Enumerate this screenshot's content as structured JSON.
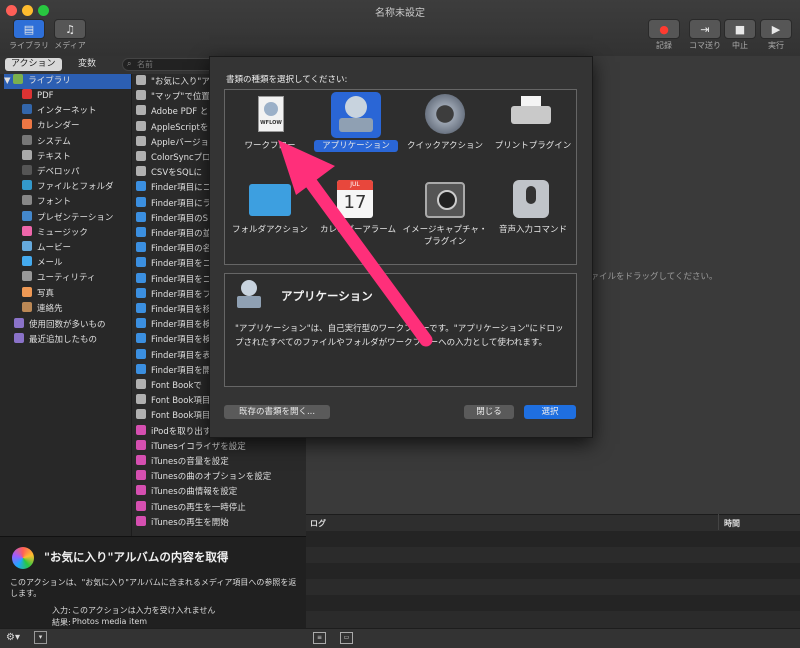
{
  "window": {
    "title": "名称未設定"
  },
  "toolbar": {
    "left": [
      {
        "label": "ライブラリ"
      },
      {
        "label": "メディア"
      }
    ],
    "right": [
      {
        "label": "記録"
      },
      {
        "label": "コマ送り"
      },
      {
        "label": "中止"
      },
      {
        "label": "実行"
      }
    ]
  },
  "tabs": {
    "actions": "アクション",
    "variables": "変数"
  },
  "search": {
    "placeholder": "名前"
  },
  "library": {
    "root": "ライブラリ",
    "items": [
      "PDF",
      "インターネット",
      "カレンダー",
      "システム",
      "テキスト",
      "デベロッパ",
      "ファイルとフォルダ",
      "フォント",
      "プレゼンテーション",
      "ミュージック",
      "ムービー",
      "メール",
      "ユーティリティ",
      "写真",
      "連絡先"
    ],
    "extra": [
      "使用回数が多いもの",
      "最近追加したもの"
    ]
  },
  "actions": [
    "\"お気に入り\"ア",
    "\"マップ\"で位置を",
    "Adobe PDF と",
    "AppleScriptを",
    "Appleバージョ",
    "ColorSyncプロ",
    "CSVをSQLに",
    "Finder項目にコ",
    "Finder項目にラ",
    "Finder項目のS",
    "Finder項目の並",
    "Finder項目の名",
    "Finder項目をコ",
    "Finder項目をコ",
    "Finder項目をフ",
    "Finder項目を移",
    "Finder項目を検",
    "Finder項目を検",
    "Finder項目を表",
    "Finder項目を開",
    "Font Bookで",
    "Font Book項目",
    "Font Book項目",
    "iPodを取り出す",
    "iTunesイコライザを設定",
    "iTunesの音量を設定",
    "iTunesの曲のオプションを設定",
    "iTunesの曲情報を設定",
    "iTunesの再生を一時停止",
    "iTunesの再生を開始"
  ],
  "description": {
    "title": "\"お気に入り\"アルバムの内容を取得",
    "body": "このアクションは、\"お気に入り\"アルバムに含まれるメディア項目への参照を返します。",
    "input_label": "入力:",
    "input_value": "このアクションは入力を受け入れません",
    "result_label": "結果:",
    "result_value": "Photos media item"
  },
  "workspace": {
    "hint": "ファイルをドラッグしてください。"
  },
  "log": {
    "col_log": "ログ",
    "col_time": "時間"
  },
  "dialog": {
    "prompt": "書類の種類を選択してください:",
    "types": [
      "ワークフロー",
      "アプリケーション",
      "クイックアクション",
      "プリントプラグイン",
      "フォルダアクション",
      "カレンダーアラーム",
      "イメージキャプチャ・プラグイン",
      "音声入力コマンド"
    ],
    "workflow_icon_text": "WFLOW",
    "calendar_icon_month": "JUL",
    "calendar_icon_day": "17",
    "selected_index": 1,
    "info_title": "アプリケーション",
    "info_body": "\"アプリケーション\"は、自己実行型のワークフローです。\"アプリケーション\"にドロップされたすべてのファイルやフォルダがワークフローへの入力として使われます。",
    "open_existing": "既存の書類を開く...",
    "close": "閉じる",
    "choose": "選択"
  },
  "colors": {
    "accent": "#1f6fe0",
    "arrow": "#ff2f7a"
  }
}
